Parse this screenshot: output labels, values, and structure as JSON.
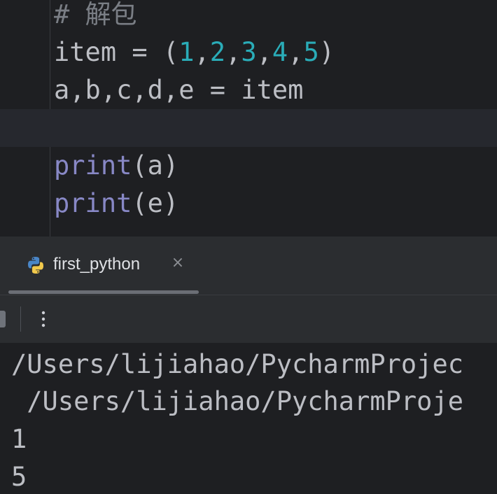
{
  "editor": {
    "lines": [
      {
        "tokens": [
          {
            "text": "# 解包",
            "kind": "comment"
          }
        ]
      },
      {
        "tokens": [
          {
            "text": "item = (",
            "kind": "plain"
          },
          {
            "text": "1",
            "kind": "num"
          },
          {
            "text": ",",
            "kind": "plain"
          },
          {
            "text": "2",
            "kind": "num"
          },
          {
            "text": ",",
            "kind": "plain"
          },
          {
            "text": "3",
            "kind": "num"
          },
          {
            "text": ",",
            "kind": "plain"
          },
          {
            "text": "4",
            "kind": "num"
          },
          {
            "text": ",",
            "kind": "plain"
          },
          {
            "text": "5",
            "kind": "num"
          },
          {
            "text": ")",
            "kind": "plain"
          }
        ]
      },
      {
        "tokens": [
          {
            "text": "a,b,c,d,e = item",
            "kind": "plain"
          }
        ]
      },
      {
        "tokens": [],
        "current": true
      },
      {
        "tokens": [
          {
            "text": "print",
            "kind": "builtin"
          },
          {
            "text": "(a)",
            "kind": "plain"
          }
        ]
      },
      {
        "tokens": [
          {
            "text": "print",
            "kind": "builtin"
          },
          {
            "text": "(e)",
            "kind": "plain"
          }
        ]
      }
    ]
  },
  "run_panel": {
    "tab_label": "first_python",
    "tab_icon": "python-icon",
    "close_icon": "close-icon",
    "more_icon": "more-vertical-icon",
    "console_lines": [
      "/Users/lijiahao/PycharmProjec",
      " /Users/lijiahao/PycharmProje",
      "1",
      "5"
    ]
  },
  "colors": {
    "background": "#1e1f22",
    "panel": "#2b2d30",
    "number": "#2aacb8",
    "builtin": "#8888c6",
    "comment": "#7a7e85",
    "text": "#bcbec4"
  }
}
